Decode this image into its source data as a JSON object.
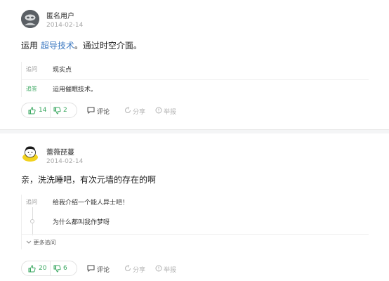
{
  "answers": [
    {
      "user": "匿名用户",
      "date": "2014-02-14",
      "text_prefix": "运用 ",
      "text_link": "超导技术",
      "text_suffix": "。通过时空介面。",
      "qa": [
        {
          "tag": "追问",
          "text": "现实点"
        },
        {
          "tag": "追答",
          "text": "运用催眠技术。"
        }
      ],
      "up_votes": "14",
      "down_votes": "2",
      "comment_label": "评论",
      "share_label": "分享",
      "report_label": "举报"
    },
    {
      "user": "蕾薇琵蔓",
      "date": "2014-02-14",
      "text": "亲，洗洗睡吧，有次元墙的存在的啊",
      "qa": [
        {
          "tag": "追问",
          "text": "给我介绍一个能人异士吧！"
        },
        {
          "tag": "",
          "text": "为什么都叫我作梦呀"
        }
      ],
      "more_label": "更多追问",
      "up_votes": "20",
      "down_votes": "6",
      "comment_label": "评论",
      "share_label": "分享",
      "report_label": "举报"
    }
  ],
  "colors": {
    "accent_green": "#3aa760",
    "link_blue": "#3e7ac2",
    "muted_gray": "#b4b4b4"
  },
  "icons": [
    "anonymous-avatar-icon",
    "cartoon-avatar-icon",
    "thumbs-up-icon",
    "thumbs-down-icon",
    "comment-icon",
    "share-icon",
    "report-icon",
    "chevron-down-icon"
  ]
}
